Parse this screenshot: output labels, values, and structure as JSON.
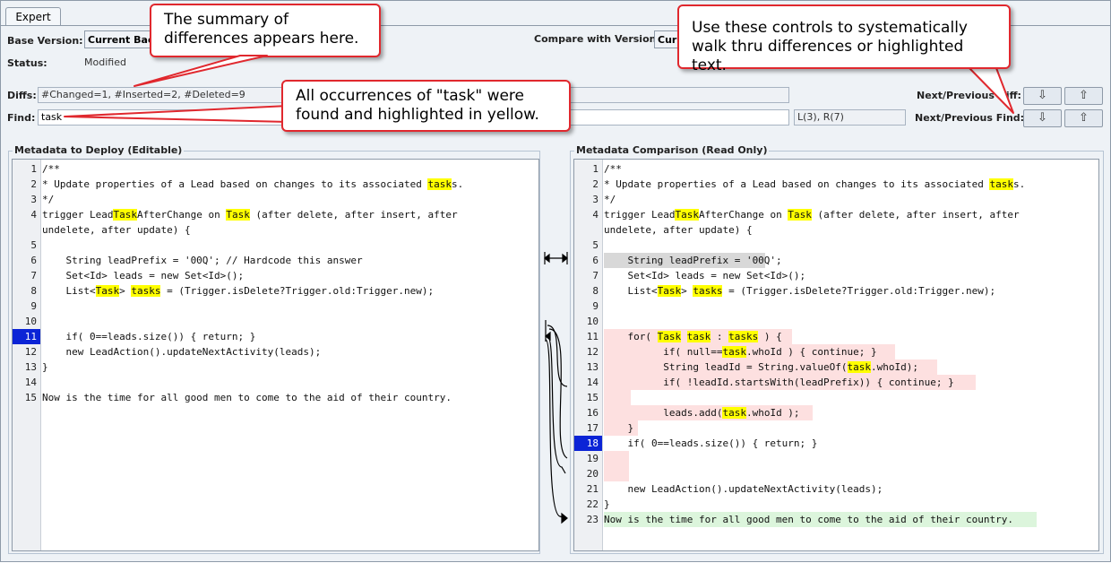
{
  "tab": {
    "label": "Expert"
  },
  "base_version": {
    "label": "Base Version:",
    "value": "Current Bac"
  },
  "compare_version": {
    "label": "Compare with Version:",
    "value": "Curr"
  },
  "status": {
    "label": "Status:",
    "value": "Modified"
  },
  "diffs": {
    "label": "Diffs:",
    "value": "#Changed=1, #Inserted=2, #Deleted=9",
    "nav_label": "Next/Previous Diff:"
  },
  "find": {
    "label": "Find:",
    "value": "task",
    "count": "L(3), R(7)",
    "nav_label": "Next/Previous Find:"
  },
  "buttons": {
    "down": "⇩",
    "up": "⇧"
  },
  "left_panel": {
    "title": "Metadata to Deploy (Editable)",
    "lines": [
      {
        "n": "1",
        "segs": [
          {
            "t": "/**"
          }
        ]
      },
      {
        "n": "2",
        "segs": [
          {
            "t": "* Update properties of a Lead based on changes to its associated "
          },
          {
            "t": "task",
            "h": true
          },
          {
            "t": "s."
          }
        ]
      },
      {
        "n": "3",
        "segs": [
          {
            "t": "*/"
          }
        ]
      },
      {
        "n": "4",
        "segs": [
          {
            "t": "trigger Lead"
          },
          {
            "t": "Task",
            "h": true
          },
          {
            "t": "AfterChange on "
          },
          {
            "t": "Task",
            "h": true
          },
          {
            "t": " (after delete, after insert, after"
          }
        ]
      },
      {
        "n": "",
        "segs": [
          {
            "t": "undelete, after update) {"
          }
        ]
      },
      {
        "n": "5",
        "segs": [
          {
            "t": ""
          }
        ]
      },
      {
        "n": "6",
        "segs": [
          {
            "t": "    String leadPrefix = '00Q'; // Hardcode this answer"
          }
        ]
      },
      {
        "n": "7",
        "segs": [
          {
            "t": "    Set<Id> leads = new Set<Id>();"
          }
        ]
      },
      {
        "n": "8",
        "segs": [
          {
            "t": "    List<"
          },
          {
            "t": "Task",
            "h": true
          },
          {
            "t": "> "
          },
          {
            "t": "task",
            "h": true
          },
          {
            "t": "s",
            "h": true
          },
          {
            "t": " = (Trigger.isDelete?Trigger.old:Trigger.new);"
          }
        ]
      },
      {
        "n": "9",
        "segs": [
          {
            "t": ""
          }
        ]
      },
      {
        "n": "10",
        "segs": [
          {
            "t": ""
          }
        ]
      },
      {
        "n": "11",
        "segs": [
          {
            "t": "    if( 0==leads.size()) { return; }"
          }
        ]
      },
      {
        "n": "12",
        "segs": [
          {
            "t": "    new LeadAction().updateNextActivity(leads);"
          }
        ]
      },
      {
        "n": "13",
        "segs": [
          {
            "t": "}"
          }
        ]
      },
      {
        "n": "14",
        "segs": [
          {
            "t": ""
          }
        ]
      },
      {
        "n": "15",
        "segs": [
          {
            "t": "Now is the time for all good men to come to the aid of their country."
          }
        ]
      }
    ]
  },
  "right_panel": {
    "title": "Metadata Comparison (Read Only)",
    "lines": [
      {
        "n": "1",
        "segs": [
          {
            "t": "/**"
          }
        ]
      },
      {
        "n": "2",
        "segs": [
          {
            "t": "* Update properties of a Lead based on changes to its associated "
          },
          {
            "t": "task",
            "h": true
          },
          {
            "t": "s."
          }
        ]
      },
      {
        "n": "3",
        "segs": [
          {
            "t": "*/"
          }
        ]
      },
      {
        "n": "4",
        "segs": [
          {
            "t": "trigger Lead"
          },
          {
            "t": "Task",
            "h": true
          },
          {
            "t": "AfterChange on "
          },
          {
            "t": "Task",
            "h": true
          },
          {
            "t": " (after delete, after insert, after"
          }
        ]
      },
      {
        "n": "",
        "segs": [
          {
            "t": "undelete, after update) {"
          }
        ]
      },
      {
        "n": "5",
        "segs": [
          {
            "t": ""
          }
        ]
      },
      {
        "n": "6",
        "segs": [
          {
            "t": "    String leadPrefix = '00Q';"
          }
        ]
      },
      {
        "n": "7",
        "segs": [
          {
            "t": "    Set<Id> leads = new Set<Id>();"
          }
        ]
      },
      {
        "n": "8",
        "segs": [
          {
            "t": "    List<"
          },
          {
            "t": "Task",
            "h": true
          },
          {
            "t": "> "
          },
          {
            "t": "tasks",
            "h": true
          },
          {
            "t": " = (Trigger.isDelete?Trigger.old:Trigger.new);"
          }
        ]
      },
      {
        "n": "9",
        "segs": [
          {
            "t": ""
          }
        ]
      },
      {
        "n": "10",
        "segs": [
          {
            "t": ""
          }
        ]
      },
      {
        "n": "11",
        "segs": [
          {
            "t": "    for( "
          },
          {
            "t": "Task",
            "h": true
          },
          {
            "t": " "
          },
          {
            "t": "task",
            "h": true
          },
          {
            "t": " : "
          },
          {
            "t": "tasks",
            "h": true
          },
          {
            "t": " ) {"
          }
        ]
      },
      {
        "n": "12",
        "segs": [
          {
            "t": "          if( null=="
          },
          {
            "t": "task",
            "h": true
          },
          {
            "t": ".whoId ) { continue; }"
          }
        ]
      },
      {
        "n": "13",
        "segs": [
          {
            "t": "          String leadId = String.valueOf("
          },
          {
            "t": "task",
            "h": true
          },
          {
            "t": ".whoId);"
          }
        ]
      },
      {
        "n": "14",
        "segs": [
          {
            "t": "          if( !leadId.startsWith(leadPrefix)) { continue; }"
          }
        ]
      },
      {
        "n": "15",
        "segs": [
          {
            "t": ""
          }
        ]
      },
      {
        "n": "16",
        "segs": [
          {
            "t": "          leads.add("
          },
          {
            "t": "task",
            "h": true
          },
          {
            "t": ".whoId );"
          }
        ]
      },
      {
        "n": "17",
        "segs": [
          {
            "t": "    }"
          }
        ]
      },
      {
        "n": "18",
        "segs": [
          {
            "t": "    if( 0==leads.size()) { return; }"
          }
        ]
      },
      {
        "n": "19",
        "segs": [
          {
            "t": ""
          }
        ]
      },
      {
        "n": "20",
        "segs": [
          {
            "t": ""
          }
        ]
      },
      {
        "n": "21",
        "segs": [
          {
            "t": "    new LeadAction().updateNextActivity(leads);"
          }
        ]
      },
      {
        "n": "22",
        "segs": [
          {
            "t": "}"
          }
        ]
      },
      {
        "n": "23",
        "segs": [
          {
            "t": "Now is the time for all good men to come to the aid of their country."
          }
        ]
      }
    ]
  },
  "callouts": {
    "summary": "The summary of differences appears here.",
    "controls": "Use these controls to systematically walk thru differences or highlighted text.",
    "find": "All occurrences of \"task\" were found and highlighted in yellow."
  },
  "colors": {
    "highlight": "#ffff00",
    "deleted_bg": "#fde0e0",
    "changed_bg": "#d8d8d8",
    "inserted_bg": "#dcf5dc",
    "selected_line": "#0b24d6",
    "callout_border": "#e0282e"
  }
}
